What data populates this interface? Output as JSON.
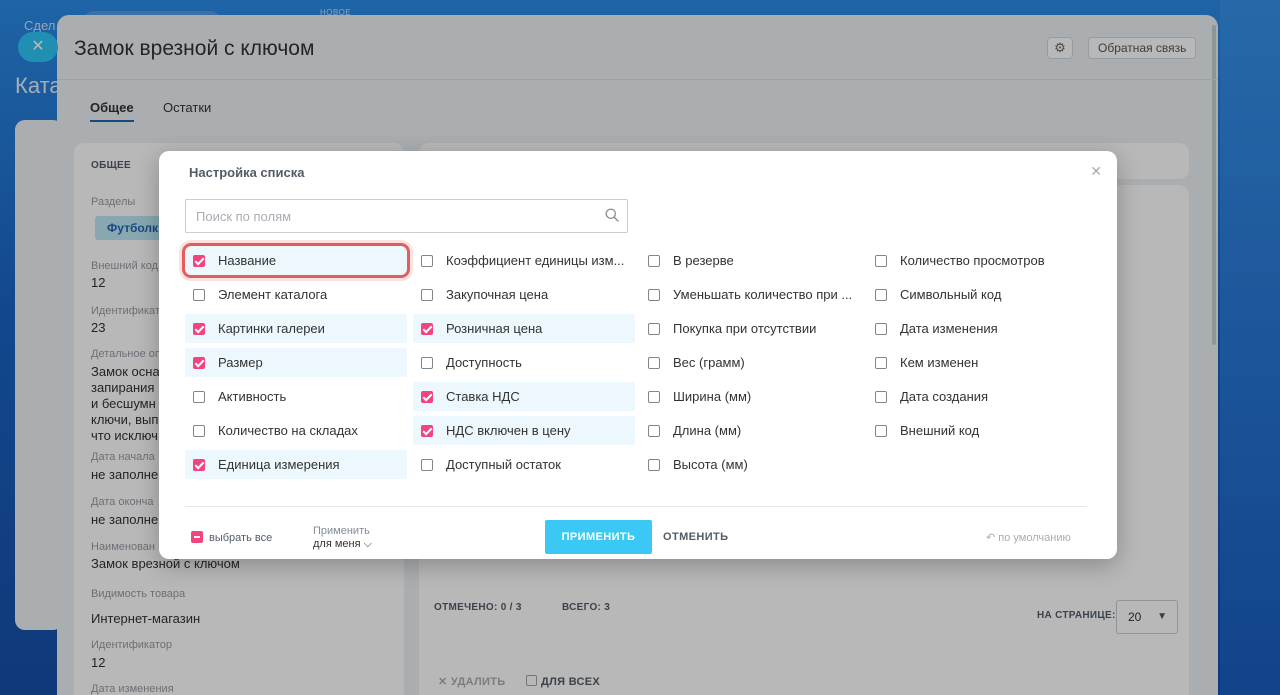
{
  "background": {
    "top_text": "Сдел",
    "new_badge": "НОВОЕ",
    "close_symbol": "✕",
    "section_title": "Ката"
  },
  "slider": {
    "title": "Замок врезной с ключом",
    "feedback_label": "Обратная связь",
    "tabs": [
      {
        "label": "Общее"
      },
      {
        "label": "Остатки"
      }
    ],
    "left": {
      "head": "ОБЩЕЕ",
      "sections_label": "Разделы",
      "section_chip": "Футболк",
      "external_code_label": "Внешний код",
      "external_code_value": "12",
      "id_label": "Идентификат",
      "id_value": "23",
      "detail_label": "Детальное оп",
      "detail_text": "Замок осна\nзапирания\nи бесшумн\nключи, вып\nчто исключ",
      "start_label": "Дата начала",
      "start_value": "не заполне",
      "end_label": "Дата оконча",
      "end_value": "не заполне",
      "name_label": "Наименован",
      "name_value": "Замок врезной с ключом",
      "visibility_label": "Видимость товара",
      "visibility_value": "Интернет-магазин",
      "identifier_label": "Идентификатор",
      "identifier_value": "12",
      "modified_label": "Дата изменения"
    },
    "right": {
      "checked_label": "ОТМЕЧЕНО:",
      "checked_value": "0 / 3",
      "total_label": "ВСЕГО:",
      "total_value": "3",
      "per_page_label": "НА СТРАНИЦЕ:",
      "per_page_value": "20",
      "delete_label": "✕ УДАЛИТЬ",
      "for_all_label": "ДЛЯ ВСЕХ"
    }
  },
  "popup": {
    "title": "Настройка списка",
    "search_placeholder": "Поиск по полям",
    "fields": [
      {
        "label": "Название",
        "checked": true
      },
      {
        "label": "Элемент каталога",
        "checked": false
      },
      {
        "label": "Картинки галереи",
        "checked": true
      },
      {
        "label": "Размер",
        "checked": true
      },
      {
        "label": "Активность",
        "checked": false
      },
      {
        "label": "Количество на складах",
        "checked": false
      },
      {
        "label": "Единица измерения",
        "checked": true
      },
      {
        "label": "Коэффициент единицы изм...",
        "checked": false
      },
      {
        "label": "Закупочная цена",
        "checked": false
      },
      {
        "label": "Розничная цена",
        "checked": true
      },
      {
        "label": "Доступность",
        "checked": false
      },
      {
        "label": "Ставка НДС",
        "checked": true
      },
      {
        "label": "НДС включен в цену",
        "checked": true
      },
      {
        "label": "Доступный остаток",
        "checked": false
      },
      {
        "label": "В резерве",
        "checked": false
      },
      {
        "label": "Уменьшать количество при ...",
        "checked": false
      },
      {
        "label": "Покупка при отсутствии",
        "checked": false
      },
      {
        "label": "Вес (грамм)",
        "checked": false
      },
      {
        "label": "Ширина (мм)",
        "checked": false
      },
      {
        "label": "Длина (мм)",
        "checked": false
      },
      {
        "label": "Высота (мм)",
        "checked": false
      },
      {
        "label": "Количество просмотров",
        "checked": false
      },
      {
        "label": "Символьный код",
        "checked": false
      },
      {
        "label": "Дата изменения",
        "checked": false
      },
      {
        "label": "Кем изменен",
        "checked": false
      },
      {
        "label": "Дата создания",
        "checked": false
      },
      {
        "label": "Внешний код",
        "checked": false
      }
    ],
    "select_all_label": "выбрать все",
    "apply_for_label": "Применить",
    "apply_for_who": "для меня",
    "apply_button": "ПРИМЕНИТЬ",
    "cancel_button": "ОТМЕНИТЬ",
    "reset_label": "по умолчанию",
    "accent_color": "#f34380",
    "apply_color": "#3bc8f5"
  }
}
